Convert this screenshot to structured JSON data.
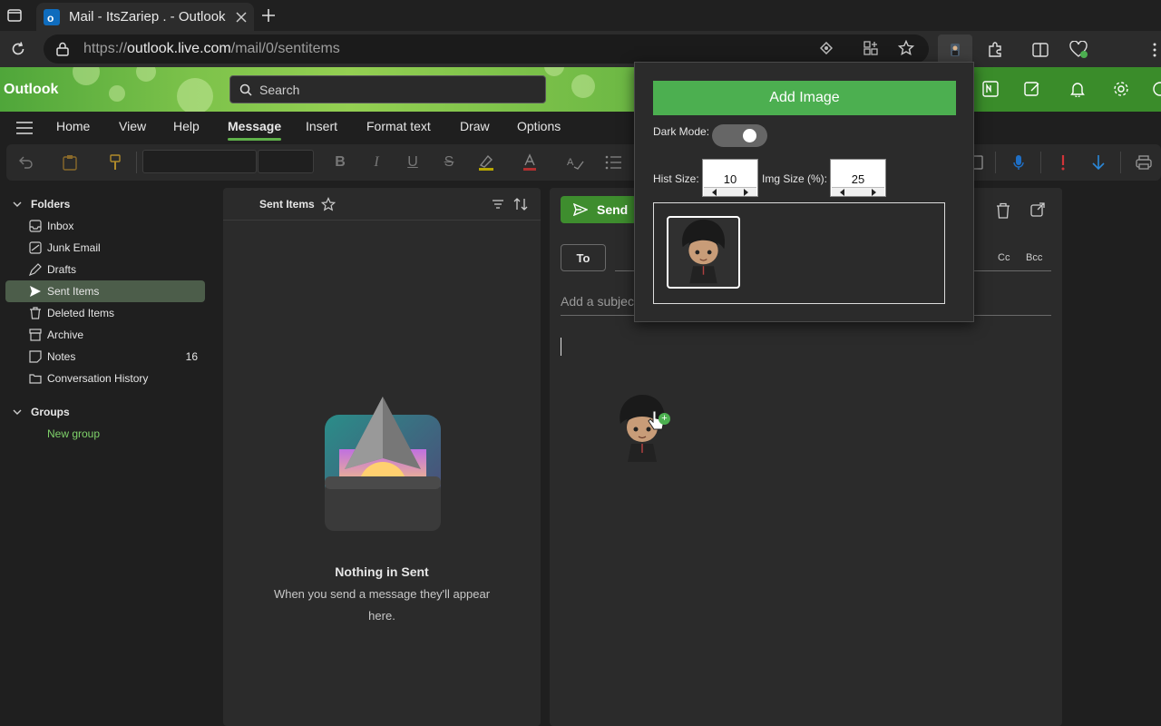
{
  "browser": {
    "tab_title": "Mail - ItsZariep . - Outlook",
    "url_scheme": "https://",
    "url_host": "outlook.live.com",
    "url_path": "/mail/0/sentitems"
  },
  "header": {
    "brand": "Outlook",
    "search_placeholder": "Search"
  },
  "ribbon": {
    "tabs": [
      "Home",
      "View",
      "Help",
      "Message",
      "Insert",
      "Format text",
      "Draw",
      "Options"
    ],
    "active_tab": "Message"
  },
  "folders": {
    "section_title": "Folders",
    "items": [
      {
        "label": "Inbox",
        "icon": "inbox-icon"
      },
      {
        "label": "Junk Email",
        "icon": "junk-icon"
      },
      {
        "label": "Drafts",
        "icon": "drafts-icon"
      },
      {
        "label": "Sent Items",
        "icon": "send-icon",
        "selected": true
      },
      {
        "label": "Deleted Items",
        "icon": "trash-icon"
      },
      {
        "label": "Archive",
        "icon": "archive-icon"
      },
      {
        "label": "Notes",
        "icon": "notes-icon",
        "count": "16"
      },
      {
        "label": "Conversation History",
        "icon": "folder-icon"
      }
    ],
    "groups_title": "Groups",
    "new_group": "New group"
  },
  "message_list": {
    "title": "Sent Items",
    "empty_title": "Nothing in Sent",
    "empty_line1": "When you send a message they'll appear",
    "empty_line2": "here."
  },
  "compose": {
    "send_label": "Send",
    "to_label": "To",
    "cc_label": "Cc",
    "bcc_label": "Bcc",
    "subject_placeholder": "Add a subjec"
  },
  "popup": {
    "add_image_label": "Add Image",
    "dark_mode_label": "Dark Mode:",
    "dark_mode_on": true,
    "hist_size_label": "Hist Size:",
    "hist_size_value": "10",
    "img_size_label": "Img Size (%):",
    "img_size_value": "25"
  },
  "colors": {
    "accent": "#4caf50",
    "send_button": "#3e8d2e",
    "selected_folder": "#4c5d4a",
    "new_group_link": "#7fd26a"
  }
}
